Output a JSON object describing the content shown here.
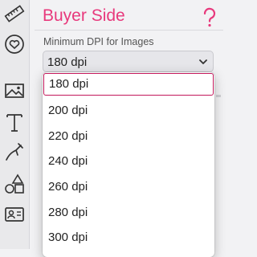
{
  "panel": {
    "title": "Buyer Side",
    "accent_color": "#e8397c",
    "help_icon": "question-mark-icon"
  },
  "dpi_setting": {
    "label": "Minimum DPI for Images",
    "selected": "180 dpi",
    "options": [
      "180 dpi",
      "200 dpi",
      "220 dpi",
      "240 dpi",
      "260 dpi",
      "280 dpi",
      "300 dpi"
    ]
  },
  "rail_icons": [
    "ruler-icon",
    "badge-icon",
    "image-icon",
    "text-icon",
    "pen-tool-icon",
    "shapes-icon",
    "id-card-icon"
  ]
}
